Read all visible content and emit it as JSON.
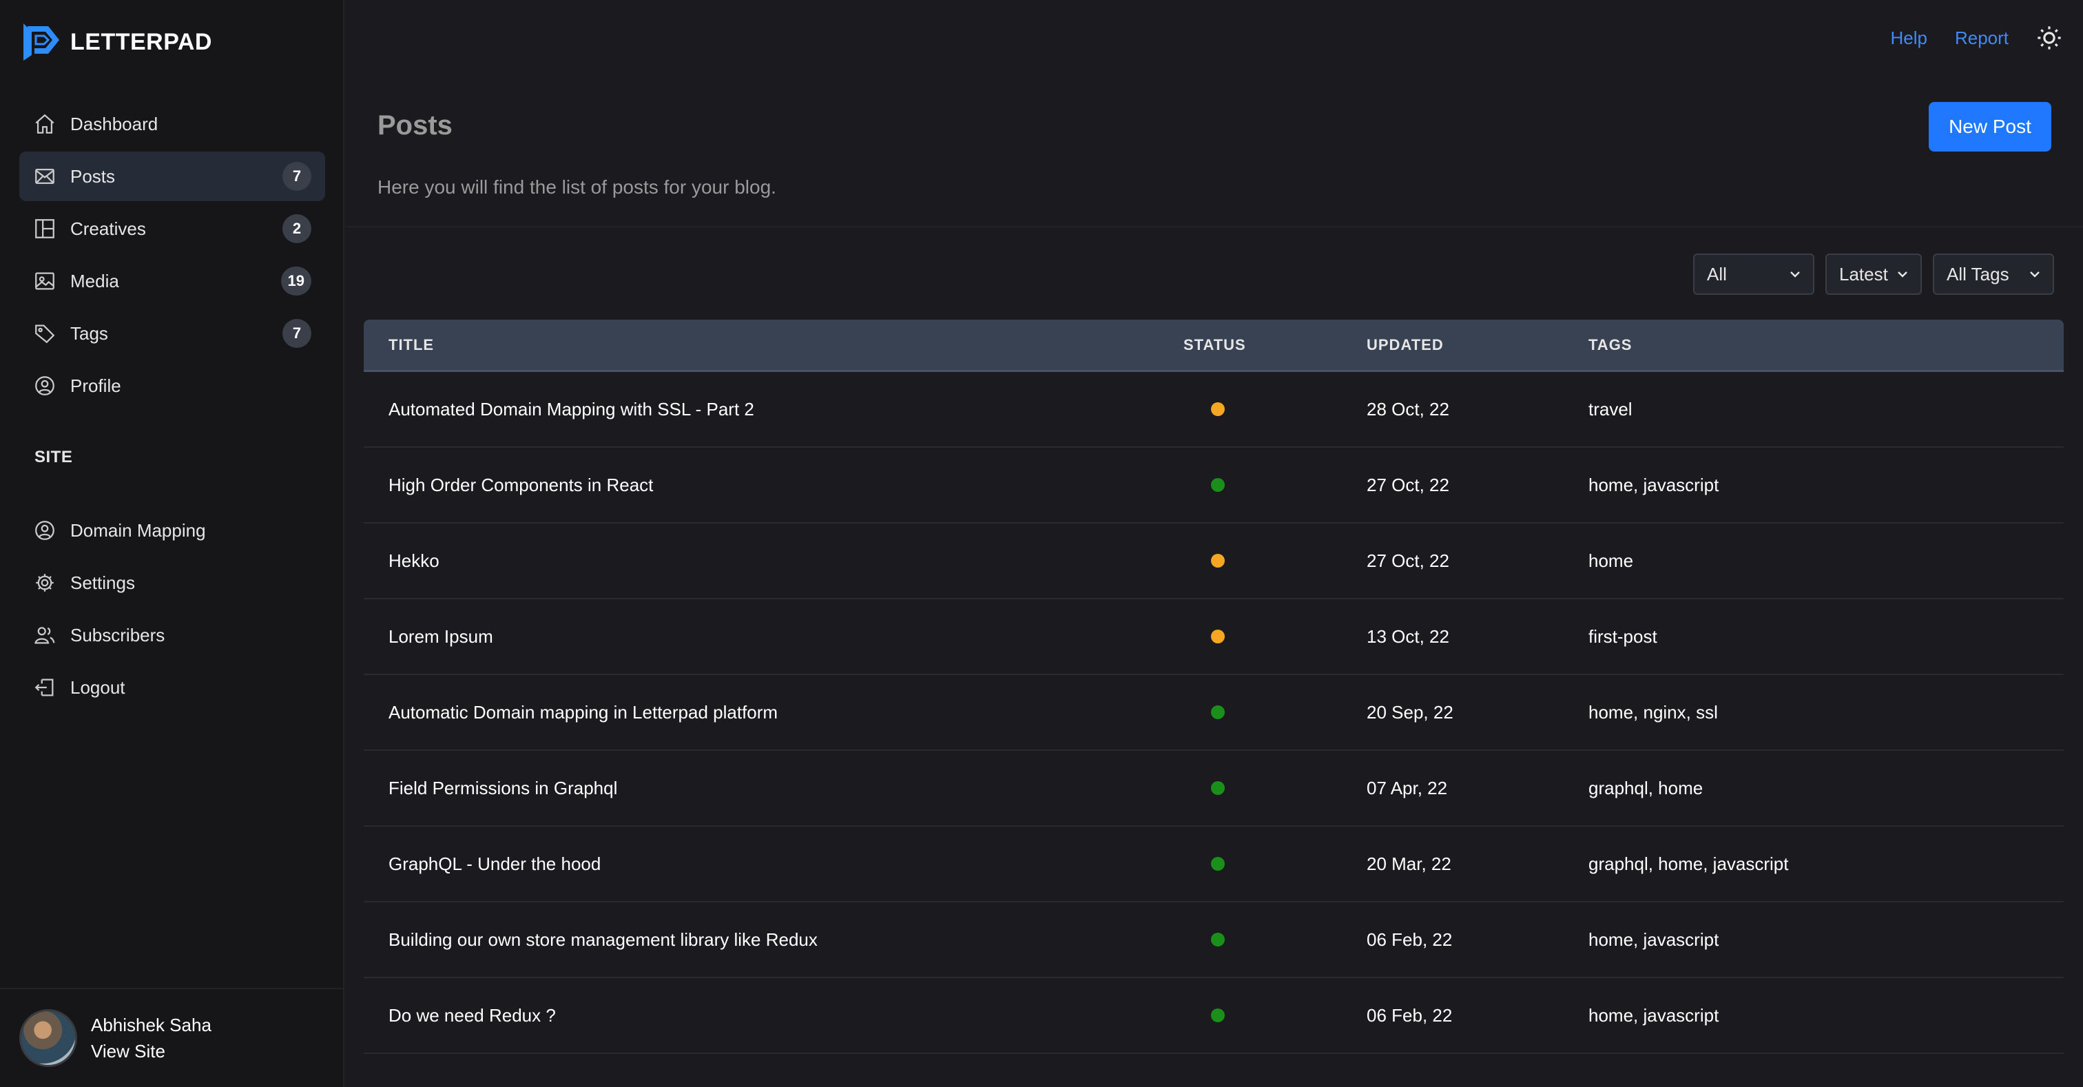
{
  "app": {
    "name": "LETTERPAD"
  },
  "colors": {
    "accent": "#1f78ff",
    "link": "#3d8bff",
    "draft": "#f5a623",
    "published": "#1a8f1a"
  },
  "topbar": {
    "help": "Help",
    "report": "Report",
    "theme_icon": "sun-icon"
  },
  "sidebar": {
    "items": [
      {
        "label": "Dashboard",
        "icon": "home-icon",
        "badge": ""
      },
      {
        "label": "Posts",
        "icon": "envelope-icon",
        "badge": "7",
        "active": true
      },
      {
        "label": "Creatives",
        "icon": "layout-icon",
        "badge": "2"
      },
      {
        "label": "Media",
        "icon": "image-icon",
        "badge": "19"
      },
      {
        "label": "Tags",
        "icon": "tag-icon",
        "badge": "7"
      },
      {
        "label": "Profile",
        "icon": "user-circle-icon",
        "badge": ""
      }
    ],
    "site_title": "SITE",
    "site_items": [
      {
        "label": "Domain Mapping",
        "icon": "user-circle-icon"
      },
      {
        "label": "Settings",
        "icon": "gear-icon"
      },
      {
        "label": "Subscribers",
        "icon": "users-icon"
      },
      {
        "label": "Logout",
        "icon": "logout-icon"
      }
    ],
    "user": {
      "name": "Abhishek Saha",
      "view_site": "View Site"
    }
  },
  "header": {
    "title": "Posts",
    "description": "Here you will find the list of posts for your blog.",
    "new_post": "New Post"
  },
  "filters": {
    "status": "All",
    "sort": "Latest",
    "tags": "All Tags"
  },
  "table": {
    "columns": [
      "TITLE",
      "STATUS",
      "UPDATED",
      "TAGS"
    ],
    "rows": [
      {
        "title": "Automated Domain Mapping with SSL - Part 2",
        "status": "draft",
        "updated": "28 Oct, 22",
        "tags": "travel"
      },
      {
        "title": "High Order Components in React",
        "status": "published",
        "updated": "27 Oct, 22",
        "tags": "home, javascript"
      },
      {
        "title": "Hekko",
        "status": "draft",
        "updated": "27 Oct, 22",
        "tags": "home"
      },
      {
        "title": "Lorem Ipsum",
        "status": "draft",
        "updated": "13 Oct, 22",
        "tags": "first-post"
      },
      {
        "title": "Automatic Domain mapping in Letterpad platform",
        "status": "published",
        "updated": "20 Sep, 22",
        "tags": "home, nginx, ssl"
      },
      {
        "title": "Field Permissions in Graphql",
        "status": "published",
        "updated": "07 Apr, 22",
        "tags": "graphql, home"
      },
      {
        "title": "GraphQL - Under the hood",
        "status": "published",
        "updated": "20 Mar, 22",
        "tags": "graphql, home, javascript"
      },
      {
        "title": "Building our own store management library like Redux",
        "status": "published",
        "updated": "06 Feb, 22",
        "tags": "home, javascript"
      },
      {
        "title": "Do we need Redux ?",
        "status": "published",
        "updated": "06 Feb, 22",
        "tags": "home, javascript"
      }
    ]
  }
}
